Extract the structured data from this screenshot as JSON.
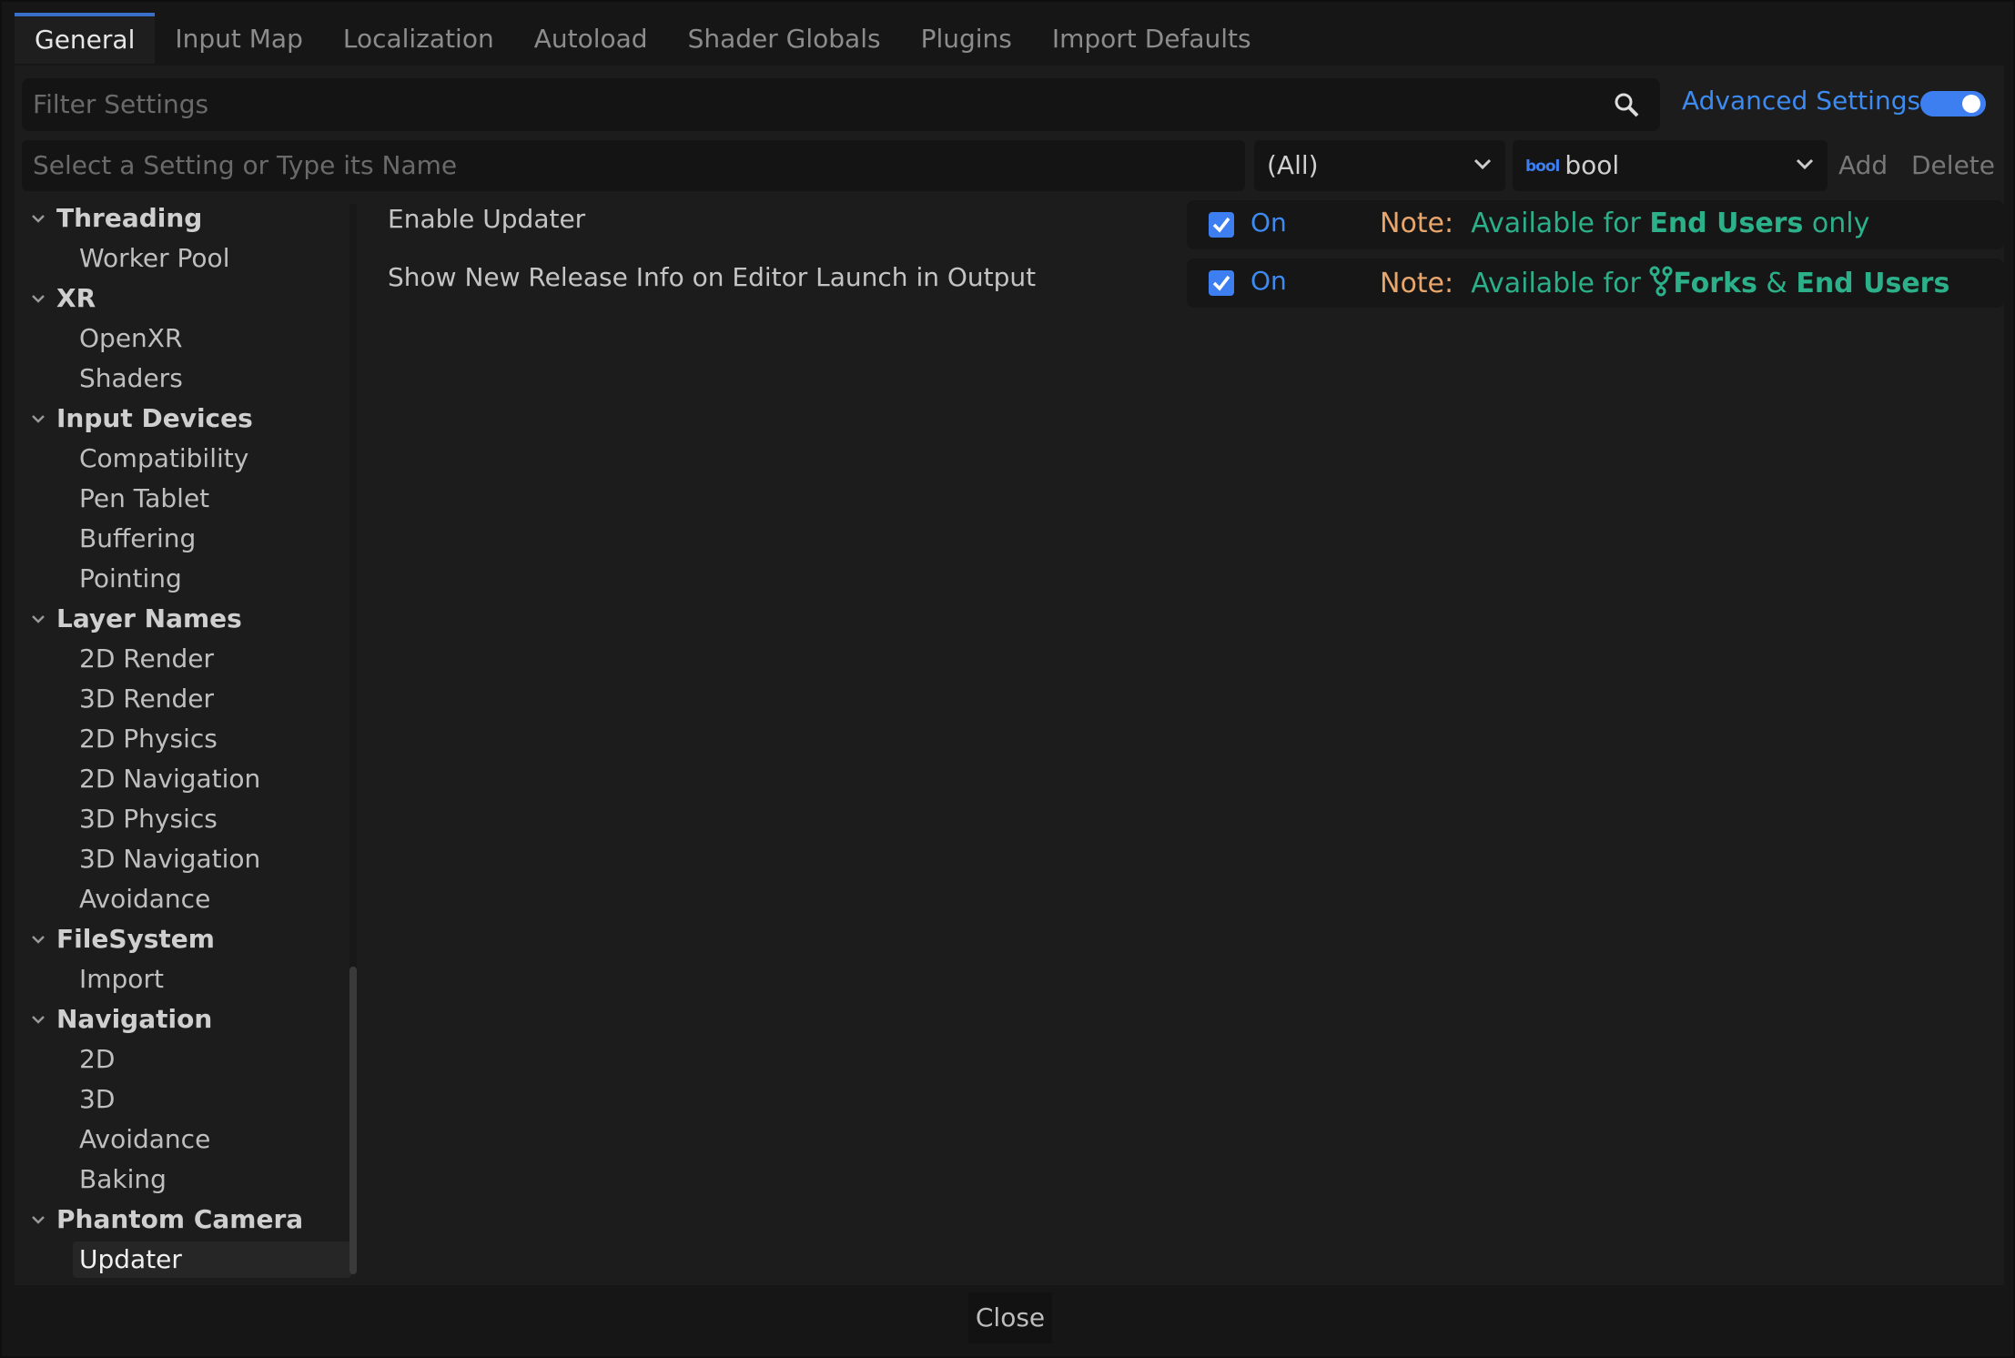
{
  "tabs": [
    "General",
    "Input Map",
    "Localization",
    "Autoload",
    "Shader Globals",
    "Plugins",
    "Import Defaults"
  ],
  "active_tab": "General",
  "filter": {
    "placeholder": "Filter Settings",
    "advanced_label": "Advanced Settings",
    "advanced_on": true
  },
  "add_setting": {
    "placeholder": "Select a Setting or Type its Name",
    "category": "(All)",
    "type_icon": "bool",
    "type": "bool",
    "add_label": "Add",
    "delete_label": "Delete"
  },
  "tree": [
    {
      "label": "Threading",
      "cat": true
    },
    {
      "label": "Worker Pool"
    },
    {
      "label": "XR",
      "cat": true
    },
    {
      "label": "OpenXR"
    },
    {
      "label": "Shaders"
    },
    {
      "label": "Input Devices",
      "cat": true
    },
    {
      "label": "Compatibility"
    },
    {
      "label": "Pen Tablet"
    },
    {
      "label": "Buffering"
    },
    {
      "label": "Pointing"
    },
    {
      "label": "Layer Names",
      "cat": true
    },
    {
      "label": "2D Render"
    },
    {
      "label": "3D Render"
    },
    {
      "label": "2D Physics"
    },
    {
      "label": "2D Navigation"
    },
    {
      "label": "3D Physics"
    },
    {
      "label": "3D Navigation"
    },
    {
      "label": "Avoidance"
    },
    {
      "label": "FileSystem",
      "cat": true
    },
    {
      "label": "Import"
    },
    {
      "label": "Navigation",
      "cat": true
    },
    {
      "label": "2D"
    },
    {
      "label": "3D"
    },
    {
      "label": "Avoidance"
    },
    {
      "label": "Baking"
    },
    {
      "label": "Phantom Camera",
      "cat": true
    },
    {
      "label": "Updater",
      "selected": true
    }
  ],
  "settings": [
    {
      "label": "Enable Updater",
      "checked": true,
      "value": "On",
      "note": "Note:",
      "avail": "Available for",
      "who": "End Users",
      "tail": "only"
    },
    {
      "label": "Show New Release Info on Editor Launch in Output",
      "checked": true,
      "value": "On",
      "note": "Note:",
      "avail": "Available for",
      "forks": "Forks",
      "amp": "&",
      "who": "End Users"
    }
  ],
  "close_label": "Close"
}
